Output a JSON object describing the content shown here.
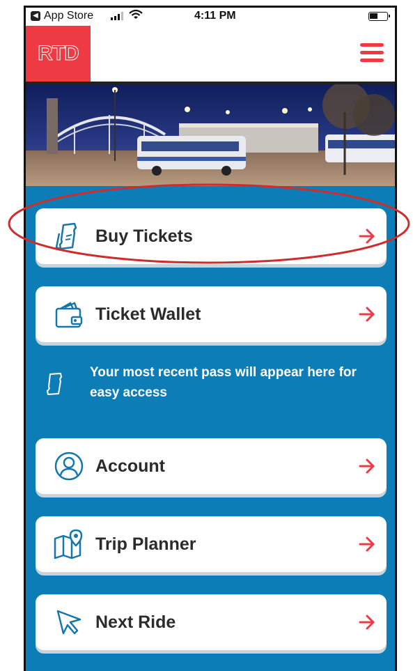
{
  "status_bar": {
    "back_app": "App Store",
    "time": "4:11 PM"
  },
  "header": {
    "logo_text": "RTD",
    "menu_icon": "hamburger-icon"
  },
  "hero": {
    "description_icon": "bus-station-photo"
  },
  "menu": [
    {
      "label": "Buy Tickets",
      "icon": "ticket-icon"
    },
    {
      "label": "Ticket Wallet",
      "icon": "wallet-icon"
    },
    {
      "label": "Account",
      "icon": "user-icon"
    },
    {
      "label": "Trip Planner",
      "icon": "map-pin-icon"
    },
    {
      "label": "Next Ride",
      "icon": "cursor-arrow-icon"
    }
  ],
  "pass_note": {
    "text": "Your most recent pass will appear here for easy access"
  },
  "colors": {
    "brand_red": "#ee3a43",
    "main_blue": "#0d7db7",
    "highlight_oval": "#cc2e2e"
  }
}
